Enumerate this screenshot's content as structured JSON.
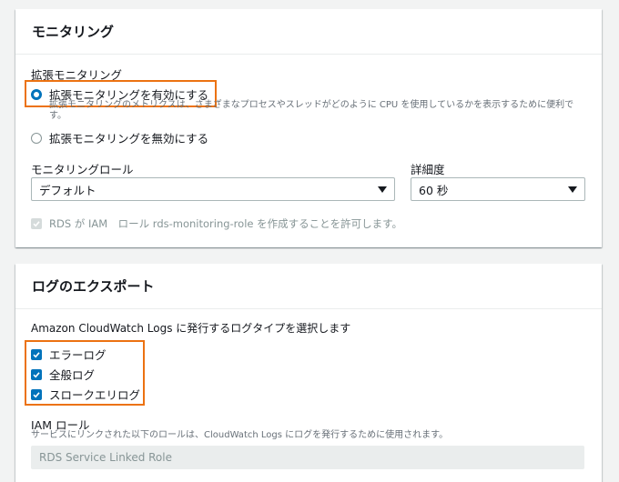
{
  "monitoring": {
    "title": "モニタリング",
    "enhanced_label": "拡張モニタリング",
    "enable_option": "拡張モニタリングを有効にする",
    "enable_desc": "拡張モニタリングのメトリクスは、さまざまなプロセスやスレッドがどのように CPU を使用しているかを表示するために便利です。",
    "disable_option": "拡張モニタリングを無効にする",
    "role_label": "モニタリングロール",
    "role_value": "デフォルト",
    "granularity_label": "詳細度",
    "granularity_value": "60 秒",
    "allow_text": "RDS が IAM　ロール rds-monitoring-role を作成することを許可します。"
  },
  "export": {
    "title": "ログのエクスポート",
    "prompt": "Amazon CloudWatch Logs に発行するログタイプを選択します",
    "log_types": [
      "エラーログ",
      "全般ログ",
      "スロークエリログ"
    ],
    "iam_role_label": "IAM ロール",
    "iam_role_desc": "サービスにリンクされた以下のロールは、CloudWatch Logs にログを発行するために使用されます。",
    "iam_role_value": "RDS Service Linked Role"
  },
  "colors": {
    "accent": "#0073bb",
    "highlight": "#ec7211"
  }
}
